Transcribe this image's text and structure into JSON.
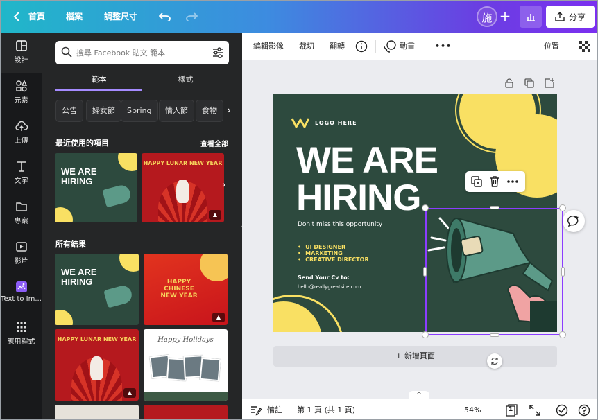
{
  "topbar": {
    "home_label": "首頁",
    "file_label": "檔案",
    "resize_label": "調整尺寸",
    "avatar_initial": "施",
    "add_label": "+",
    "share_label": "分享",
    "gradient_start": "#20b7c9",
    "gradient_end": "#7b2ff0"
  },
  "rail": {
    "items": [
      {
        "label": "設計",
        "icon": "layout-icon",
        "active": true
      },
      {
        "label": "元素",
        "icon": "shapes-icon"
      },
      {
        "label": "上傳",
        "icon": "upload-cloud-icon"
      },
      {
        "label": "文字",
        "icon": "text-icon"
      },
      {
        "label": "專案",
        "icon": "folder-icon"
      },
      {
        "label": "影片",
        "icon": "video-icon"
      },
      {
        "label": "Text to Im...",
        "icon": "text-to-image-icon"
      },
      {
        "label": "應用程式",
        "icon": "apps-grid-icon"
      }
    ]
  },
  "panel": {
    "search_placeholder": "搜尋 Facebook 貼文 範本",
    "tabs": [
      "範本",
      "樣式"
    ],
    "chips": [
      "公告",
      "婦女節",
      "Spring",
      "情人節",
      "食物"
    ],
    "recent_title": "最近使用的項目",
    "see_all": "查看全部",
    "all_results_title": "所有結果",
    "thumbs": {
      "hire_text": "WE ARE HIRING",
      "red_text": "HAPPY LUNAR NEW YEAR",
      "cny_text": "HAPPY CHINESE NEW YEAR",
      "holiday_text": "Happy Holidays"
    }
  },
  "toolbar": {
    "edit_image": "編輯影像",
    "crop": "裁切",
    "flip": "翻轉",
    "animate": "動畫",
    "more": "•••",
    "position": "位置"
  },
  "design": {
    "logo_text": "LOGO HERE",
    "headline_line1": "WE ARE",
    "headline_line2": "HIRING",
    "tagline": "Don't miss this opportunity",
    "roles": [
      "UI DESIGNER",
      "MARKETING",
      "CREATIVE DIRECTOR"
    ],
    "send_label": "Send Your Cv to:",
    "email": "hello@reallygreatsite.com",
    "bg_color": "#2d4a3e",
    "accent_color": "#f9e063",
    "selection_color": "#8b3dff"
  },
  "editor": {
    "add_page_label": "+ 新增頁面",
    "up_label": "^"
  },
  "footer": {
    "notes_label": "備註",
    "page_indicator": "第 1 頁 (共 1 頁)",
    "zoom": "54%",
    "page_count": "1"
  }
}
